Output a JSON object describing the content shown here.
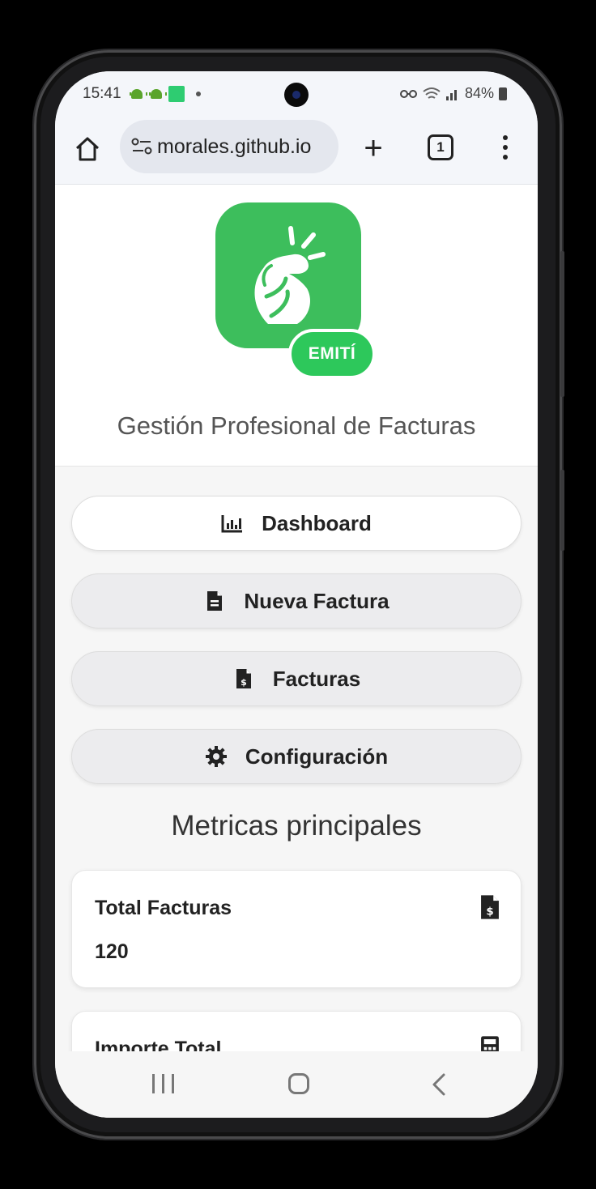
{
  "status_bar": {
    "time": "15:41",
    "battery": "84%",
    "icons": [
      "android-icon",
      "android-icon",
      "notification-square-icon",
      "dot-icon",
      "vpn-key-icon",
      "wifi-icon",
      "signal-icon",
      "battery-icon"
    ]
  },
  "browser": {
    "url": "morales.github.io",
    "tab_count": "1"
  },
  "app": {
    "logo_badge": "EMITÍ",
    "subtitle": "Gestión Profesional de Facturas",
    "brand_color": "#3dbe5c"
  },
  "nav": {
    "dashboard": "Dashboard",
    "new_invoice": "Nueva Factura",
    "invoices": "Facturas",
    "settings": "Configuración"
  },
  "metrics": {
    "title": "Metricas principales",
    "cards": [
      {
        "label": "Total Facturas",
        "value": "120",
        "icon": "invoice-dollar-icon"
      },
      {
        "label": "Importe Total",
        "value": "",
        "icon": "calculator-icon"
      }
    ]
  }
}
